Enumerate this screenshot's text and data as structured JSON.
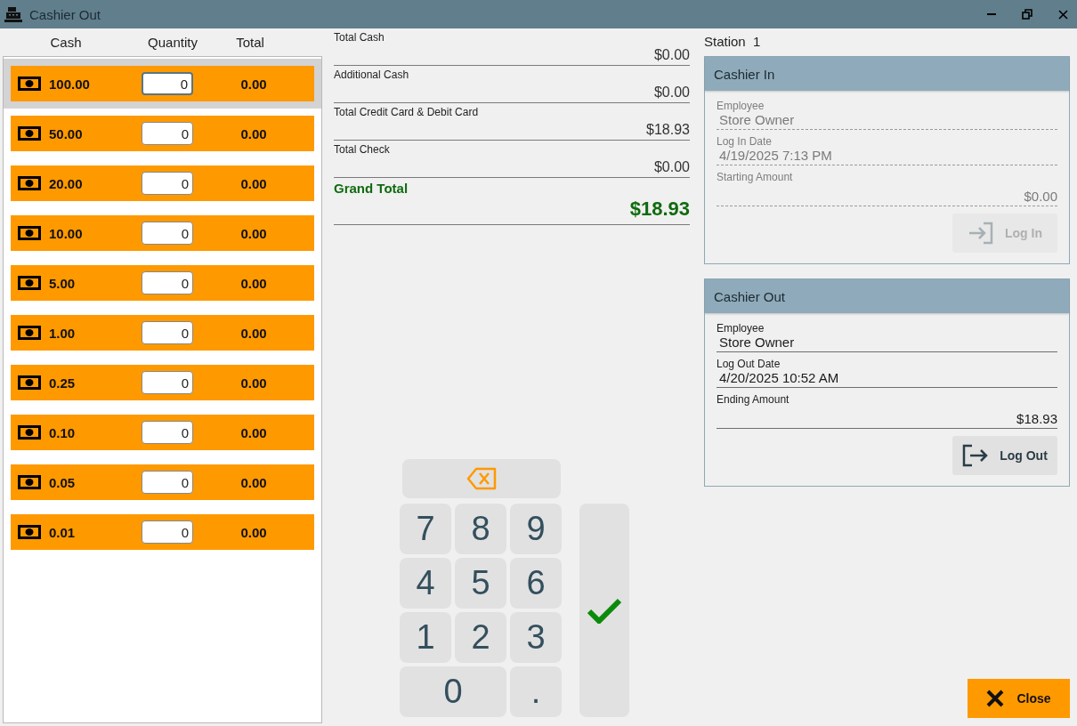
{
  "window": {
    "title": "Cashier Out"
  },
  "cash_table": {
    "columns": [
      "Cash",
      "Quantity",
      "Total"
    ],
    "rows": [
      {
        "denomination": "100.00",
        "quantity": "0",
        "total": "0.00",
        "selected": true
      },
      {
        "denomination": "50.00",
        "quantity": "0",
        "total": "0.00",
        "selected": false
      },
      {
        "denomination": "20.00",
        "quantity": "0",
        "total": "0.00",
        "selected": false
      },
      {
        "denomination": "10.00",
        "quantity": "0",
        "total": "0.00",
        "selected": false
      },
      {
        "denomination": "5.00",
        "quantity": "0",
        "total": "0.00",
        "selected": false
      },
      {
        "denomination": "1.00",
        "quantity": "0",
        "total": "0.00",
        "selected": false
      },
      {
        "denomination": "0.25",
        "quantity": "0",
        "total": "0.00",
        "selected": false
      },
      {
        "denomination": "0.10",
        "quantity": "0",
        "total": "0.00",
        "selected": false
      },
      {
        "denomination": "0.05",
        "quantity": "0",
        "total": "0.00",
        "selected": false
      },
      {
        "denomination": "0.01",
        "quantity": "0",
        "total": "0.00",
        "selected": false
      }
    ]
  },
  "summary": [
    {
      "kind": "line",
      "label": "Total Cash",
      "value": "$0.00"
    },
    {
      "kind": "line",
      "label": "Additional Cash",
      "value": "$0.00"
    },
    {
      "kind": "line",
      "label": "Total Credit Card & Debit Card",
      "value": "$18.93"
    },
    {
      "kind": "line",
      "label": "Total Check",
      "value": "$0.00"
    },
    {
      "kind": "grand",
      "label": "Grand Total",
      "value": "$18.93"
    }
  ],
  "keypad": {
    "keys": [
      {
        "kind": "backspace"
      },
      {
        "kind": "digit",
        "label": "7"
      },
      {
        "kind": "digit",
        "label": "8"
      },
      {
        "kind": "digit",
        "label": "9"
      },
      {
        "kind": "enter"
      },
      {
        "kind": "digit",
        "label": "4"
      },
      {
        "kind": "digit",
        "label": "5"
      },
      {
        "kind": "digit",
        "label": "6"
      },
      {
        "kind": "digit",
        "label": "1"
      },
      {
        "kind": "digit",
        "label": "2"
      },
      {
        "kind": "digit",
        "label": "3"
      },
      {
        "kind": "wide",
        "label": "0"
      },
      {
        "kind": "digit",
        "label": "."
      }
    ]
  },
  "station": {
    "label": "Station",
    "number": "1"
  },
  "panels": [
    {
      "title": "Cashier In",
      "disabled": true,
      "fields": [
        {
          "label": "Employee",
          "value": "Store Owner",
          "kind": "text"
        },
        {
          "label": "Log In Date",
          "value": "4/19/2025 7:13 PM",
          "kind": "text"
        },
        {
          "label": "Starting Amount",
          "value": "$0.00",
          "kind": "amount"
        }
      ],
      "button": {
        "label": "Log In",
        "kind": "login",
        "disabled": true
      }
    },
    {
      "title": "Cashier Out",
      "disabled": false,
      "fields": [
        {
          "label": "Employee",
          "value": "Store Owner",
          "kind": "text"
        },
        {
          "label": "Log Out Date",
          "value": "4/20/2025 10:52 AM",
          "kind": "text"
        },
        {
          "label": "Ending Amount",
          "value": "$18.93",
          "kind": "amount"
        }
      ],
      "button": {
        "label": "Log Out",
        "kind": "logout",
        "disabled": false
      }
    }
  ],
  "close_button": {
    "label": "Close"
  }
}
